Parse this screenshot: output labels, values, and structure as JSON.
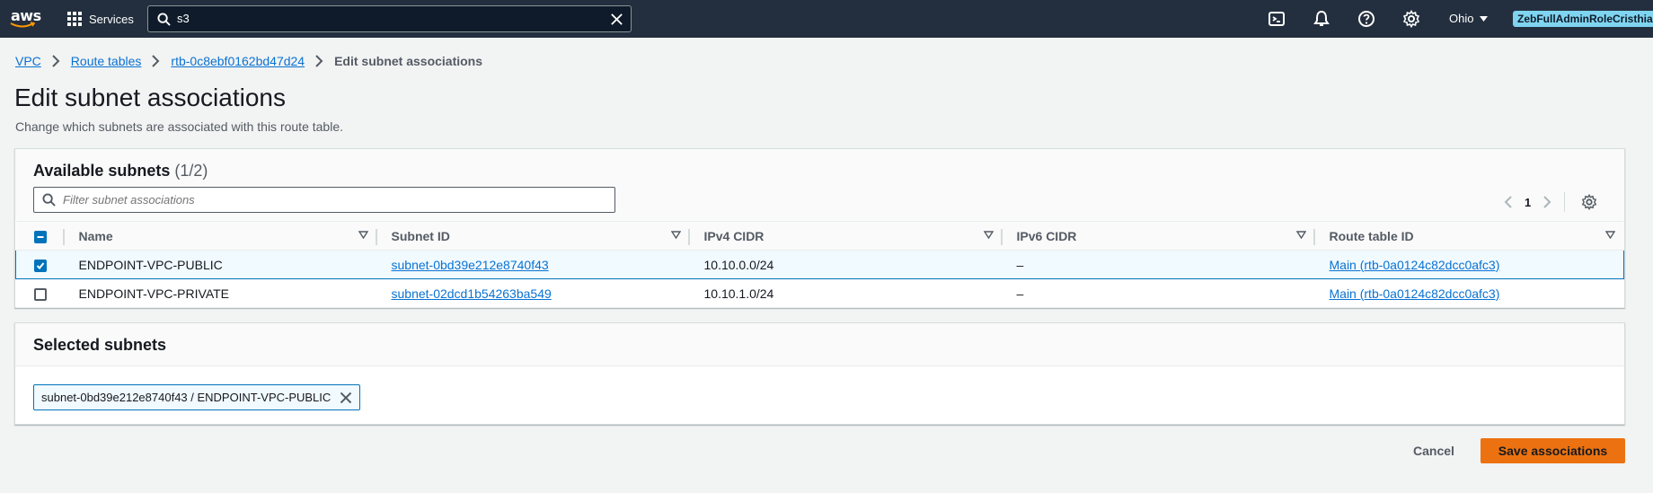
{
  "topnav": {
    "logo_text": "aws",
    "services_label": "Services",
    "search_value": "s3",
    "region_label": "Ohio",
    "role_label": "ZebFullAdminRoleCristhian",
    "icons": [
      "cloudshell-icon",
      "bell-icon",
      "help-icon",
      "settings-icon"
    ]
  },
  "breadcrumb": {
    "items": [
      "VPC",
      "Route tables",
      "rtb-0c8ebf0162bd47d24"
    ],
    "current": "Edit subnet associations"
  },
  "page": {
    "title": "Edit subnet associations",
    "description": "Change which subnets are associated with this route table."
  },
  "available": {
    "title": "Available subnets",
    "count": "(1/2)",
    "filter_placeholder": "Filter subnet associations",
    "page_number": "1",
    "columns": [
      "Name",
      "Subnet ID",
      "IPv4 CIDR",
      "IPv6 CIDR",
      "Route table ID"
    ],
    "rows": [
      {
        "selected": true,
        "name": "ENDPOINT-VPC-PUBLIC",
        "subnet_id": "subnet-0bd39e212e8740f43",
        "ipv4": "10.10.0.0/24",
        "ipv6": "–",
        "route_table": "Main (rtb-0a0124c82dcc0afc3)"
      },
      {
        "selected": false,
        "name": "ENDPOINT-VPC-PRIVATE",
        "subnet_id": "subnet-02dcd1b54263ba549",
        "ipv4": "10.10.1.0/24",
        "ipv6": "–",
        "route_table": "Main (rtb-0a0124c82dcc0afc3)"
      }
    ]
  },
  "selected": {
    "title": "Selected subnets",
    "token": "subnet-0bd39e212e8740f43 / ENDPOINT-VPC-PUBLIC"
  },
  "actions": {
    "cancel": "Cancel",
    "save": "Save associations"
  },
  "colors": {
    "nav_bg": "#232f3e",
    "link": "#0972d3",
    "primary_button": "#ec7211",
    "selected_row": "#f1faff",
    "selected_border": "#0073bb",
    "role_badge": "#7fd4f0"
  }
}
